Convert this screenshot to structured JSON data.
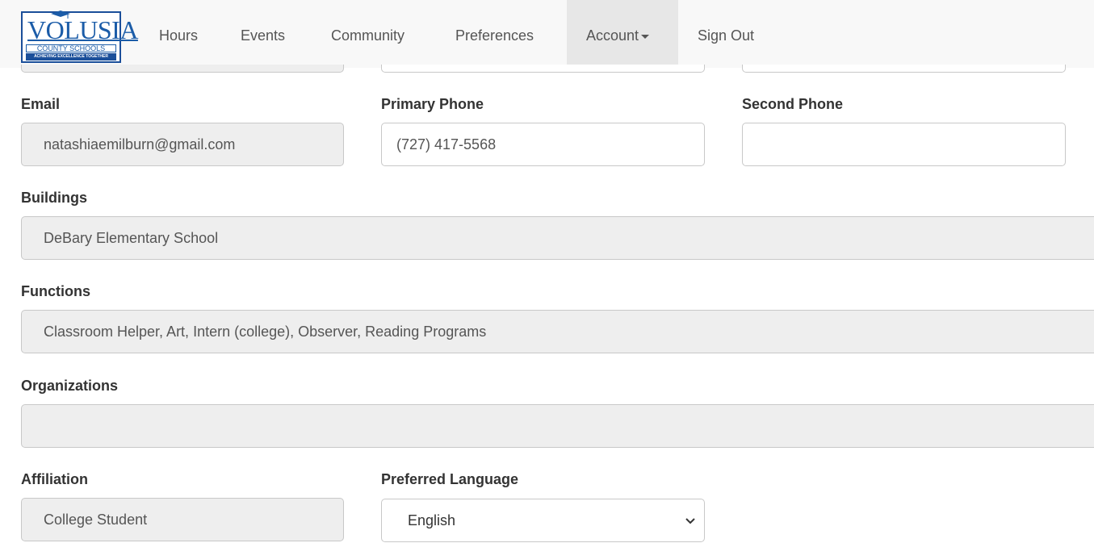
{
  "logo": {
    "name": "VOLUSIA",
    "line1": "COUNTY SCHOOLS",
    "line2": "ACHIEVING EXCELLENCE TOGETHER"
  },
  "nav": {
    "items": [
      "Hours",
      "Events",
      "Community",
      "Preferences",
      "Account",
      "Sign Out"
    ],
    "active": "Account"
  },
  "form": {
    "email": {
      "label": "Email",
      "value": "natashiaemilburn@gmail.com"
    },
    "primary_phone": {
      "label": "Primary Phone",
      "value": "(727) 417-5568"
    },
    "second_phone": {
      "label": "Second Phone",
      "value": ""
    },
    "buildings": {
      "label": "Buildings",
      "value": "DeBary Elementary School"
    },
    "functions": {
      "label": "Functions",
      "value": "Classroom Helper, Art, Intern (college), Observer, Reading Programs"
    },
    "organizations": {
      "label": "Organizations",
      "value": ""
    },
    "affiliation": {
      "label": "Affiliation",
      "value": "College Student"
    },
    "preferred_language": {
      "label": "Preferred Language",
      "value": "English"
    }
  }
}
